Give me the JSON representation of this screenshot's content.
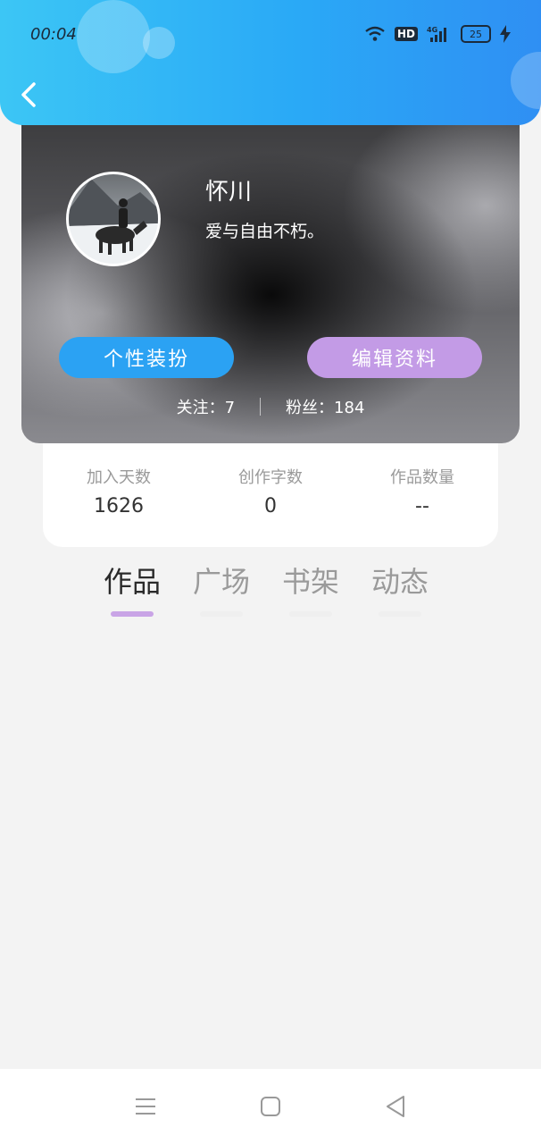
{
  "status_bar": {
    "time": "00:04",
    "hd_label": "HD",
    "network": "4G",
    "battery": "25",
    "icons": [
      "wifi-icon",
      "hd-icon",
      "signal-4g-icon",
      "battery-icon",
      "charging-icon"
    ]
  },
  "header": {
    "back_icon": "chevron-left-icon",
    "color": "#2aa9f6"
  },
  "profile": {
    "username": "怀川",
    "bio": "爱与自由不朽。",
    "buttons": {
      "style_label": "个性装扮",
      "edit_label": "编辑资料"
    },
    "following_text": "关注：7",
    "followers_text": "粉丝：184"
  },
  "stats": [
    {
      "label": "加入天数",
      "value": "1626"
    },
    {
      "label": "创作字数",
      "value": "0"
    },
    {
      "label": "作品数量",
      "value": "--"
    }
  ],
  "tabs": [
    {
      "label": "作品",
      "active": true
    },
    {
      "label": "广场",
      "active": false
    },
    {
      "label": "书架",
      "active": false
    },
    {
      "label": "动态",
      "active": false
    }
  ],
  "nav_bar": {
    "icons": [
      "menu-icon",
      "home-square-icon",
      "back-triangle-icon"
    ]
  },
  "colors": {
    "accent_blue": "#2ba2f3",
    "accent_purple": "#c39be6",
    "tab_indicator": "#c9a4e6"
  }
}
